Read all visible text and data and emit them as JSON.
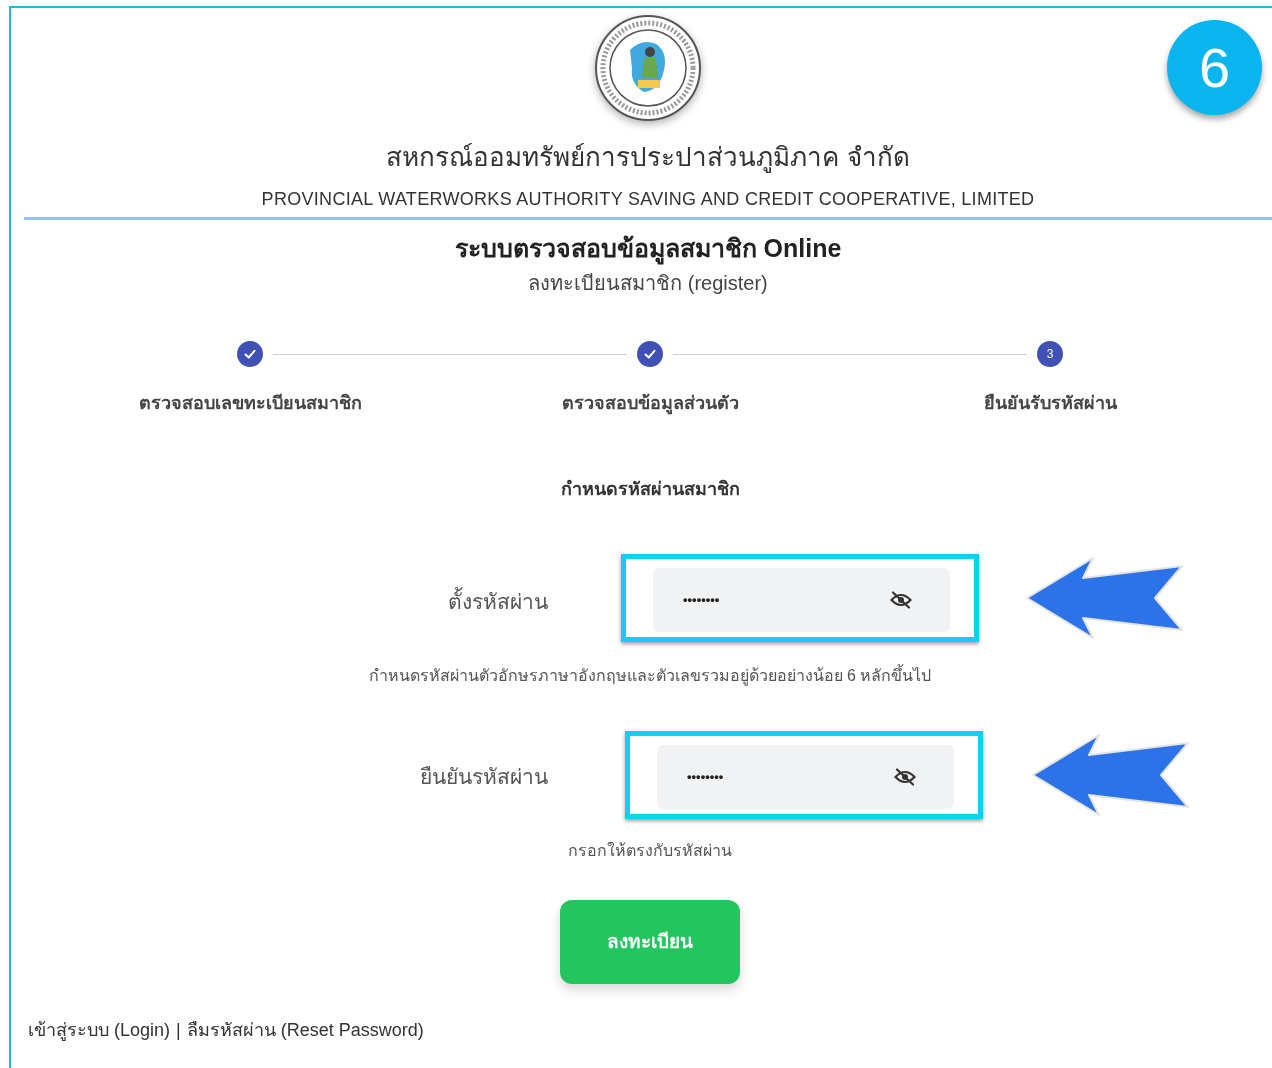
{
  "badge": "6",
  "header": {
    "title_th": "สหกรณ์ออมทรัพย์การประปาส่วนภูมิภาค จำกัด",
    "title_en": "PROVINCIAL WATERWORKS AUTHORITY SAVING AND CREDIT COOPERATIVE, LIMITED"
  },
  "page_title": "ระบบตรวจสอบข้อมูลสมาชิก Online",
  "subtitle": "ลงทะเบียนสมาชิก (register)",
  "steps": [
    {
      "label": "ตรวจสอบเลขทะเบียนสมาชิก",
      "completed": true
    },
    {
      "label": "ตรวจสอบข้อมูลส่วนตัว",
      "completed": true
    },
    {
      "label": "ยืนยันรับรหัสผ่าน",
      "completed": false,
      "number": "3"
    }
  ],
  "section_title": "กำหนดรหัสผ่านสมาชิก",
  "fields": [
    {
      "label": "ตั้งรหัสผ่าน",
      "value": "••••••••",
      "hint": "กำหนดรหัสผ่านตัวอักษรภาษาอังกฤษและตัวเลขรวมอยู่ด้วยอย่างน้อย 6 หลักขึ้นไป",
      "highlighted": true
    },
    {
      "label": "ยืนยันรหัสผ่าน",
      "value": "••••••••",
      "hint": "กรอกให้ตรงกับรหัสผ่าน",
      "highlighted": true
    }
  ],
  "submit_button": "ลงทะเบียน",
  "footer_links": [
    "เข้าสู่ระบบ (Login)",
    "ลืมรหัสผ่าน (Reset Password)"
  ],
  "footer_separator": "|"
}
